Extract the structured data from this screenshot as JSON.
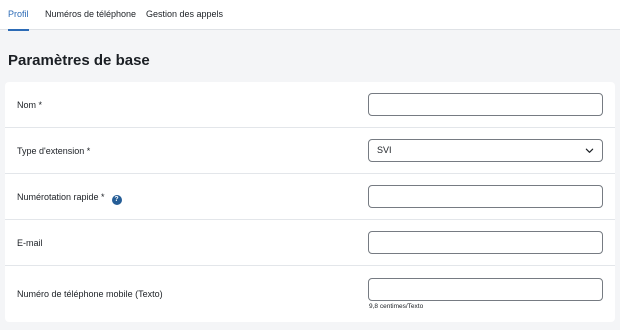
{
  "tabs": [
    {
      "label": "Profil",
      "active": true
    },
    {
      "label": "Numéros de téléphone",
      "active": false
    },
    {
      "label": "Gestion des appels",
      "active": false
    }
  ],
  "section": {
    "title": "Paramètres de base"
  },
  "form": {
    "name": {
      "label": "Nom *",
      "value": ""
    },
    "extension_type": {
      "label": "Type d'extension *",
      "value": "SVI",
      "icon": "chevron-down-icon"
    },
    "speed_dial": {
      "label": "Numérotation rapide *",
      "value": "",
      "help_icon": "?"
    },
    "email": {
      "label": "E-mail",
      "value": ""
    },
    "mobile": {
      "label": "Numéro de téléphone mobile (Texto)",
      "value": "",
      "hint": "9,8 centimes/Texto"
    }
  },
  "colors": {
    "accent": "#2c6bb6",
    "help_icon": "#255d96",
    "background": "#f4f5f7"
  }
}
